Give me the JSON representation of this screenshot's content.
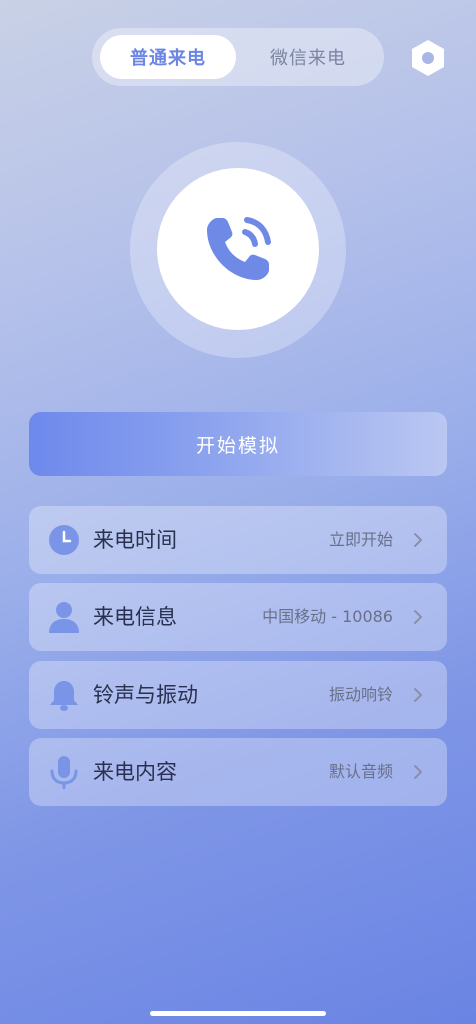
{
  "tabs": [
    {
      "label": "普通来电",
      "active": true
    },
    {
      "label": "微信来电",
      "active": false
    }
  ],
  "start_button": {
    "label": "开始模拟"
  },
  "rows": [
    {
      "label": "来电时间",
      "value": "立即开始",
      "icon": "clock-icon"
    },
    {
      "label": "来电信息",
      "value": "中国移动 - 10086",
      "icon": "person-icon"
    },
    {
      "label": "铃声与振动",
      "value": "振动响铃",
      "icon": "bell-icon"
    },
    {
      "label": "来电内容",
      "value": "默认音频",
      "icon": "microphone-icon"
    }
  ],
  "colors": {
    "accent": "#6c86e6",
    "icon": "#7a95e8",
    "bg_top": "#c9d1e6",
    "bg_bottom": "#6a84e4"
  }
}
